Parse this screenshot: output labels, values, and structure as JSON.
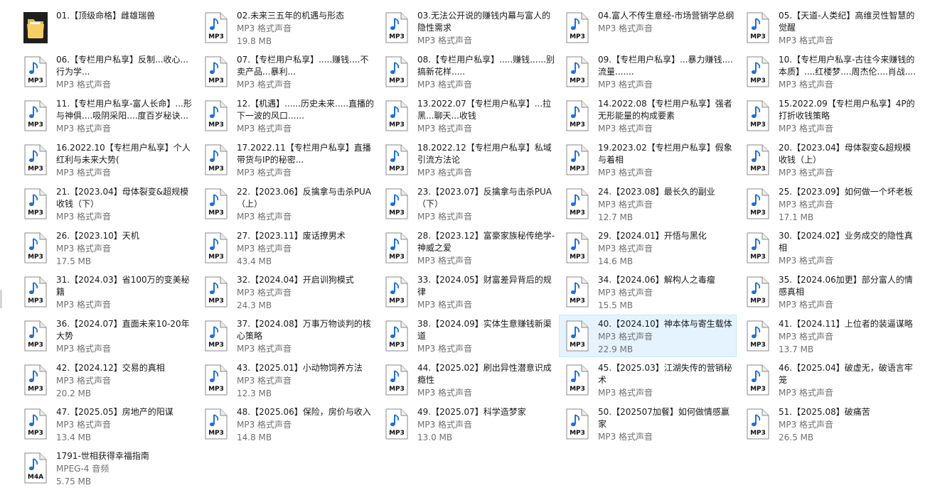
{
  "colors": {
    "background": "#ffffff",
    "selected_bg": "#e5f3ff",
    "selected_border": "#cce8ff",
    "name_text": "#1a1a1a",
    "meta_text": "#707070",
    "note_blue": "#1e6fd9"
  },
  "items": [
    {
      "name": "01.【顶级命格】雌雄瑞兽",
      "type": "",
      "size": "",
      "icon": "folder-icon",
      "ext": ""
    },
    {
      "name": "02.未来三五年的机遇与形态",
      "type": "MP3 格式声音",
      "size": "19.8 MB",
      "icon": "mp3-icon",
      "ext": "MP3"
    },
    {
      "name": "03.无法公开说的赚钱内幕与富人的隐性需求",
      "type": "MP3 格式声音",
      "size": "",
      "icon": "mp3-icon",
      "ext": "MP3"
    },
    {
      "name": "04.富人不传生意经-市场营销学总纲",
      "type": "MP3 格式声音",
      "size": "",
      "icon": "mp3-icon",
      "ext": "MP3"
    },
    {
      "name": "05.【天道-人类纪】高维灵性智慧的觉醒",
      "type": "MP3 格式声音",
      "size": "",
      "icon": "mp3-icon",
      "ext": "MP3"
    },
    {
      "name": "06.【专栏用户私享】反制...收心...行为学...",
      "type": "MP3 格式声音",
      "size": "",
      "icon": "mp3-icon",
      "ext": "MP3"
    },
    {
      "name": "07.【专栏用户私享】.....赚钱....不卖产品...暴利...",
      "type": "MP3 格式声音",
      "size": "",
      "icon": "mp3-icon",
      "ext": "MP3"
    },
    {
      "name": "08.【专栏用户私享】.....赚钱......别搞新花样.....",
      "type": "MP3 格式声音",
      "size": "",
      "icon": "mp3-icon",
      "ext": "MP3"
    },
    {
      "name": "09.【专栏用户私享】...暴力赚钱....流量.......",
      "type": "MP3 格式声音",
      "size": "",
      "icon": "mp3-icon",
      "ext": "MP3"
    },
    {
      "name": "10.【专栏用户私享-古往今来赚钱的本质】....红楼梦....周杰伦....肖战....",
      "type": "MP3 格式声音",
      "size": "",
      "icon": "mp3-icon",
      "ext": "MP3"
    },
    {
      "name": "11.【专栏用户私享-富人长命】...形与神俱....吸阴采阳....度百岁秘诀...",
      "type": "MP3 格式声音",
      "size": "",
      "icon": "mp3-icon",
      "ext": "MP3"
    },
    {
      "name": "12.【机遇】......历史未来.....直播的下一波的风口......",
      "type": "MP3 格式声音",
      "size": "",
      "icon": "mp3-icon",
      "ext": "MP3"
    },
    {
      "name": "13.2022.07【专栏用户私享】...拉黑...聊天...收钱",
      "type": "MP3 格式声音",
      "size": "",
      "icon": "mp3-icon",
      "ext": "MP3"
    },
    {
      "name": "14.2022.08【专栏用户私享】强者无形能量的构成要素",
      "type": "MP3 格式声音",
      "size": "",
      "icon": "mp3-icon",
      "ext": "MP3"
    },
    {
      "name": "15.2022.09【专栏用户私享】4P的打折收钱策略",
      "type": "MP3 格式声音",
      "size": "",
      "icon": "mp3-icon",
      "ext": "MP3"
    },
    {
      "name": "16.2022.10【专栏用户私享】个人红利与未来大势(",
      "type": "MP3 格式声音",
      "size": "",
      "icon": "mp3-icon",
      "ext": "MP3"
    },
    {
      "name": "17.2022.11【专栏用户私享】直播带货与IP的秘密...",
      "type": "MP3 格式声音",
      "size": "",
      "icon": "mp3-icon",
      "ext": "MP3"
    },
    {
      "name": "18.2022.12【专栏用户私享】私域引流方法论",
      "type": "MP3 格式声音",
      "size": "",
      "icon": "mp3-icon",
      "ext": "MP3"
    },
    {
      "name": "19.2023.02【专栏用户私享】假象与着相",
      "type": "MP3 格式声音",
      "size": "",
      "icon": "mp3-icon",
      "ext": "MP3"
    },
    {
      "name": "20.【2023.04】母体裂变&超规模收钱（上）",
      "type": "MP3 格式声音",
      "size": "",
      "icon": "mp3-icon",
      "ext": "MP3"
    },
    {
      "name": "21.【2023.04】母体裂变&超规模收钱（下）",
      "type": "MP3 格式声音",
      "size": "",
      "icon": "mp3-icon",
      "ext": "MP3"
    },
    {
      "name": "22.【2023.06】反擒拿与击杀PUA（上）",
      "type": "MP3 格式声音",
      "size": "",
      "icon": "mp3-icon",
      "ext": "MP3"
    },
    {
      "name": "23.【2023.07】反擒拿与击杀PUA（下）",
      "type": "MP3 格式声音",
      "size": "",
      "icon": "mp3-icon",
      "ext": "MP3"
    },
    {
      "name": "24.【2023.08】最长久的副业",
      "type": "MP3 格式声音",
      "size": "12.7 MB",
      "icon": "mp3-icon",
      "ext": "MP3"
    },
    {
      "name": "25.【2023.09】如何做一个坏老板",
      "type": "MP3 格式声音",
      "size": "17.1 MB",
      "icon": "mp3-icon",
      "ext": "MP3"
    },
    {
      "name": "26.【2023.10】天机",
      "type": "MP3 格式声音",
      "size": "17.5 MB",
      "icon": "mp3-icon",
      "ext": "MP3"
    },
    {
      "name": "27.【2023.11】废话撩男术",
      "type": "MP3 格式声音",
      "size": "43.4 MB",
      "icon": "mp3-icon",
      "ext": "MP3"
    },
    {
      "name": "28.【2023.12】富豪家族秘传绝学-神威之爱",
      "type": "MP3 格式声音",
      "size": "",
      "icon": "mp3-icon",
      "ext": "MP3"
    },
    {
      "name": "29.【2024.01】开悟与黑化",
      "type": "MP3 格式声音",
      "size": "14.6 MB",
      "icon": "mp3-icon",
      "ext": "MP3"
    },
    {
      "name": "30.【2024.02】业务成交的隐性真相",
      "type": "MP3 格式声音",
      "size": "",
      "icon": "mp3-icon",
      "ext": "MP3"
    },
    {
      "name": "31.【2024.03】省100万的变美秘籍",
      "type": "MP3 格式声音",
      "size": "",
      "icon": "mp3-icon",
      "ext": "MP3"
    },
    {
      "name": "32.【2024.04】开启训狗模式",
      "type": "MP3 格式声音",
      "size": "24.3 MB",
      "icon": "mp3-icon",
      "ext": "MP3"
    },
    {
      "name": "33.【2024.05】财富差异背后的规律",
      "type": "MP3 格式声音",
      "size": "",
      "icon": "mp3-icon",
      "ext": "MP3"
    },
    {
      "name": "34.【2024.06】解构人之毒瘤",
      "type": "MP3 格式声音",
      "size": "15.5 MB",
      "icon": "mp3-icon",
      "ext": "MP3"
    },
    {
      "name": "35.【2024.06加更】部分富人的情感真相",
      "type": "MP3 格式声音",
      "size": "",
      "icon": "mp3-icon",
      "ext": "MP3"
    },
    {
      "name": "36.【2024.07】直面未来10-20年大势",
      "type": "MP3 格式声音",
      "size": "",
      "icon": "mp3-icon",
      "ext": "MP3"
    },
    {
      "name": "37.【2024.08】万事万物谈判的核心策略",
      "type": "MP3 格式声音",
      "size": "",
      "icon": "mp3-icon",
      "ext": "MP3"
    },
    {
      "name": "38.【2024.09】实体生意赚钱新渠道",
      "type": "MP3 格式声音",
      "size": "",
      "icon": "mp3-icon",
      "ext": "MP3"
    },
    {
      "name": "40.【2024.10】神本体与寄生载体",
      "type": "MP3 格式声音",
      "size": "22.9 MB",
      "icon": "mp3-icon",
      "ext": "MP3",
      "selected": true
    },
    {
      "name": "41.【2024.11】上位者的装逼谋略",
      "type": "MP3 格式声音",
      "size": "13.7 MB",
      "icon": "mp3-icon",
      "ext": "MP3"
    },
    {
      "name": "42.【2024.12】交易的真相",
      "type": "MP3 格式声音",
      "size": "20.2 MB",
      "icon": "mp3-icon",
      "ext": "MP3"
    },
    {
      "name": "43.【2025.01】小动物饲养方法",
      "type": "MP3 格式声音",
      "size": "12.3 MB",
      "icon": "mp3-icon",
      "ext": "MP3"
    },
    {
      "name": "44.【2025.02】刷出异性潜意识成瘾性",
      "type": "MP3 格式声音",
      "size": "",
      "icon": "mp3-icon",
      "ext": "MP3"
    },
    {
      "name": "45.【2025.03】江湖失传的营销秘术",
      "type": "MP3 格式声音",
      "size": "",
      "icon": "mp3-icon",
      "ext": "MP3"
    },
    {
      "name": "46.【2025.04】破虚无，破语言牢笼",
      "type": "MP3 格式声音",
      "size": "",
      "icon": "mp3-icon",
      "ext": "MP3"
    },
    {
      "name": "47.【2025.05】房地产的阳谋",
      "type": "MP3 格式声音",
      "size": "13.4 MB",
      "icon": "mp3-icon",
      "ext": "MP3"
    },
    {
      "name": "48.【2025.06】保险，房价与收入",
      "type": "MP3 格式声音",
      "size": "14.8 MB",
      "icon": "mp3-icon",
      "ext": "MP3"
    },
    {
      "name": "49.【2025.07】科学造梦家",
      "type": "MP3 格式声音",
      "size": "13.0 MB",
      "icon": "mp3-icon",
      "ext": "MP3"
    },
    {
      "name": "50.【202507加餐】如何做情感赢家",
      "type": "MP3 格式声音",
      "size": "",
      "icon": "mp3-icon",
      "ext": "MP3"
    },
    {
      "name": "51.【2025.08】破痛苦",
      "type": "MP3 格式声音",
      "size": "26.5 MB",
      "icon": "mp3-icon",
      "ext": "MP3"
    },
    {
      "name": "1791-世相获得幸福指南",
      "type": "MPEG-4 音频",
      "size": "5.75 MB",
      "icon": "m4a-icon",
      "ext": "M4A"
    }
  ]
}
